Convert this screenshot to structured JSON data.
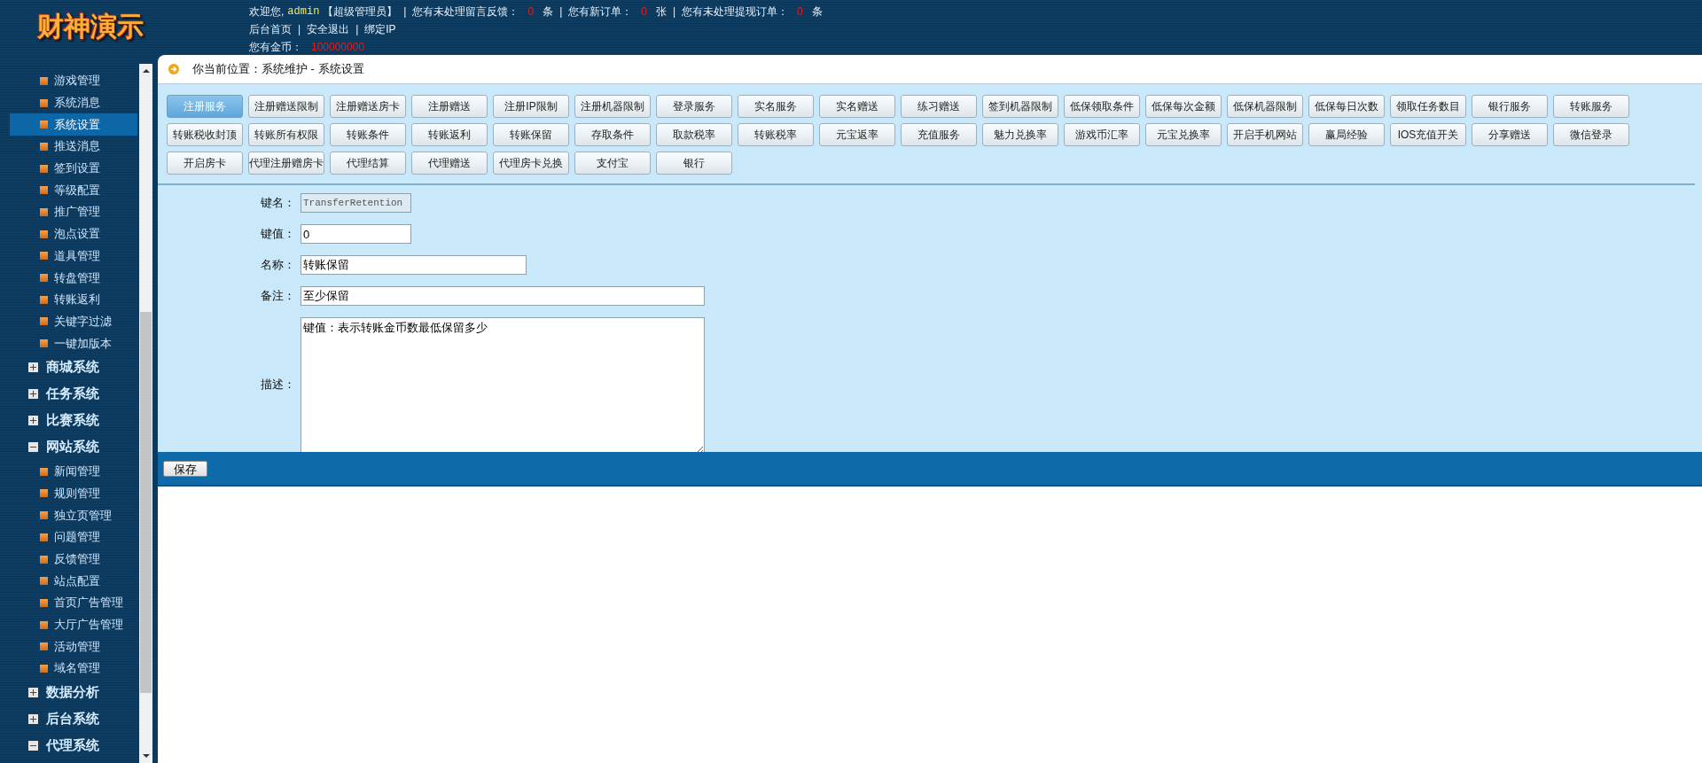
{
  "header": {
    "logo": "财神演示",
    "greeting": "欢迎您,",
    "username": "admin",
    "role": "【超级管理员】",
    "notices": [
      {
        "separator": "|",
        "label": "您有未处理留言反馈：",
        "count": "0",
        "unit": "条"
      },
      {
        "separator": "|",
        "label": "您有新订单：",
        "count": "0",
        "unit": "张"
      },
      {
        "separator": "|",
        "label": "您有未处理提现订单：",
        "count": "0",
        "unit": "条"
      }
    ],
    "links": [
      {
        "label": "后台首页"
      },
      {
        "separator": "|",
        "label": "安全退出"
      },
      {
        "separator": "|",
        "label": "绑定IP"
      }
    ],
    "coins": {
      "label": "您有金币：",
      "value": "100000000"
    }
  },
  "sidebar": {
    "sections": [
      {
        "items": [
          {
            "label": "游戏管理",
            "selected": false
          },
          {
            "label": "系统消息",
            "selected": false
          },
          {
            "label": "系统设置",
            "selected": true
          },
          {
            "label": "推送消息",
            "selected": false
          },
          {
            "label": "签到设置",
            "selected": false
          },
          {
            "label": "等级配置",
            "selected": false
          },
          {
            "label": "推广管理",
            "selected": false
          },
          {
            "label": "泡点设置",
            "selected": false
          },
          {
            "label": "道具管理",
            "selected": false
          },
          {
            "label": "转盘管理",
            "selected": false
          },
          {
            "label": "转账返利",
            "selected": false
          },
          {
            "label": "关键字过滤",
            "selected": false
          },
          {
            "label": "一键加版本",
            "selected": false
          }
        ]
      },
      {
        "title": "商城系统",
        "expanded": false
      },
      {
        "title": "任务系统",
        "expanded": false
      },
      {
        "title": "比赛系统",
        "expanded": false
      },
      {
        "title": "网站系统",
        "expanded": true,
        "items": [
          {
            "label": "新闻管理",
            "selected": false
          },
          {
            "label": "规则管理",
            "selected": false
          },
          {
            "label": "独立页管理",
            "selected": false
          },
          {
            "label": "问题管理",
            "selected": false
          },
          {
            "label": "反馈管理",
            "selected": false
          },
          {
            "label": "站点配置",
            "selected": false
          },
          {
            "label": "首页广告管理",
            "selected": false
          },
          {
            "label": "大厅广告管理",
            "selected": false
          },
          {
            "label": "活动管理",
            "selected": false
          },
          {
            "label": "域名管理",
            "selected": false
          }
        ]
      },
      {
        "title": "数据分析",
        "expanded": false
      },
      {
        "title": "后台系统",
        "expanded": false
      },
      {
        "title": "代理系统",
        "expanded": true
      }
    ]
  },
  "breadcrumb": "你当前位置：系统维护 - 系统设置",
  "tabs": [
    {
      "label": "注册服务",
      "selected": true
    },
    {
      "label": "注册赠送限制",
      "selected": false
    },
    {
      "label": "注册赠送房卡",
      "selected": false
    },
    {
      "label": "注册赠送",
      "selected": false
    },
    {
      "label": "注册IP限制",
      "selected": false
    },
    {
      "label": "注册机器限制",
      "selected": false
    },
    {
      "label": "登录服务",
      "selected": false
    },
    {
      "label": "实名服务",
      "selected": false
    },
    {
      "label": "实名赠送",
      "selected": false
    },
    {
      "label": "练习赠送",
      "selected": false
    },
    {
      "label": "签到机器限制",
      "selected": false
    },
    {
      "label": "低保领取条件",
      "selected": false
    },
    {
      "label": "低保每次金额",
      "selected": false
    },
    {
      "label": "低保机器限制",
      "selected": false
    },
    {
      "label": "低保每日次数",
      "selected": false
    },
    {
      "label": "领取任务数目",
      "selected": false
    },
    {
      "label": "银行服务",
      "selected": false
    },
    {
      "label": "转账服务",
      "selected": false
    },
    {
      "label": "转账税收封顶",
      "selected": false
    },
    {
      "label": "转账所有权限",
      "selected": false
    },
    {
      "label": "转账条件",
      "selected": false
    },
    {
      "label": "转账返利",
      "selected": false
    },
    {
      "label": "转账保留",
      "selected": false
    },
    {
      "label": "存取条件",
      "selected": false
    },
    {
      "label": "取款税率",
      "selected": false
    },
    {
      "label": "转账税率",
      "selected": false
    },
    {
      "label": "元宝返率",
      "selected": false
    },
    {
      "label": "充值服务",
      "selected": false
    },
    {
      "label": "魅力兑换率",
      "selected": false
    },
    {
      "label": "游戏币汇率",
      "selected": false
    },
    {
      "label": "元宝兑换率",
      "selected": false
    },
    {
      "label": "开启手机网站",
      "selected": false
    },
    {
      "label": "赢局经验",
      "selected": false
    },
    {
      "label": "IOS充值开关",
      "selected": false
    },
    {
      "label": "分享赠送",
      "selected": false
    },
    {
      "label": "微信登录",
      "selected": false
    },
    {
      "label": "开启房卡",
      "selected": false
    },
    {
      "label": "代理注册赠房卡",
      "selected": false
    },
    {
      "label": "代理结算",
      "selected": false
    },
    {
      "label": "代理赠送",
      "selected": false
    },
    {
      "label": "代理房卡兑换",
      "selected": false
    },
    {
      "label": "支付宝",
      "selected": false
    },
    {
      "label": "银行",
      "selected": false
    }
  ],
  "form": {
    "fields": [
      {
        "kind": "short",
        "label": "键名：",
        "value": "TransferRetention",
        "disabled": true
      },
      {
        "kind": "short",
        "label": "键值：",
        "value": "0",
        "disabled": false
      },
      {
        "kind": "medium",
        "label": "名称：",
        "value": "转账保留",
        "disabled": false
      },
      {
        "kind": "long",
        "label": "备注：",
        "value": "至少保留",
        "disabled": false
      },
      {
        "kind": "textarea",
        "label": "描述：",
        "value": "键值：表示转账金币数最低保留多少",
        "disabled": false
      }
    ],
    "save_button": "保存"
  }
}
